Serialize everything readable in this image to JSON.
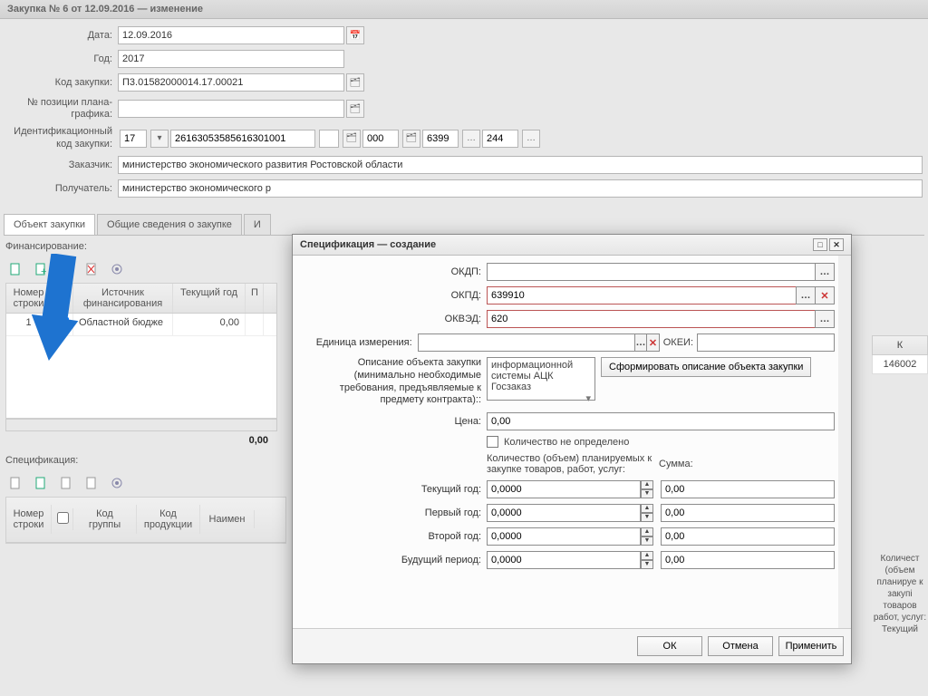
{
  "main": {
    "title": "Закупка № 6 от 12.09.2016 — изменение",
    "labels": {
      "date": "Дата:",
      "year": "Год:",
      "purchase_code": "Код закупки:",
      "plan_position": "№ позиции плана-графика:",
      "id_code": "Идентификационный код закупки:",
      "customer": "Заказчик:",
      "recipient": "Получатель:"
    },
    "values": {
      "date": "12.09.2016",
      "year": "2017",
      "purchase_code": "П3.01582000014.17.00021",
      "id1": "17",
      "id2": "26163053585616301001",
      "id3": "000",
      "id4": "6399",
      "id5": "244",
      "customer": "министерство экономического развития Ростовской области",
      "recipient": "министерство экономического р"
    }
  },
  "tabs": {
    "t1": "Объект закупки",
    "t2": "Общие сведения о закупке",
    "t3": "И"
  },
  "financing": {
    "label": "Финансирование:",
    "cols": {
      "row_no": "Номер строки",
      "chk": " ",
      "source": "Источник финансирования",
      "current": "Текущий год",
      "p": "П"
    },
    "row": {
      "no": "1",
      "source": "Областной бюдже",
      "current": "0,00"
    },
    "total": "0,00"
  },
  "spec_section": {
    "label": "Спецификация:"
  },
  "spec_grid": {
    "cols": {
      "row_no": "Номер строки",
      "chk": " ",
      "group_code": "Код группы",
      "prod_code": "Код продукции",
      "name": "Наимен"
    }
  },
  "rightcol": {
    "head": "К",
    "val": "146002"
  },
  "rightblock2": "Количест (объем планируе к закупі товаров работ, услуг: Текущий",
  "dialog": {
    "title": "Спецификация — создание",
    "labels": {
      "okdp": "ОКДП:",
      "okpd": "ОКПД:",
      "okved": "ОКВЭД:",
      "unit": "Единица измерения:",
      "okei": "ОКЕИ:",
      "description": "Описание объекта закупки (минимально необходимые требования, предъявляемые к предмету контракта)::",
      "gen_button": "Сформировать описание объекта закупки",
      "price": "Цена:",
      "qty_undef": "Количество не определено",
      "qty_header": "Количество (объем) планируемых к закупке товаров, работ, услуг:",
      "sum_header": "Сумма:",
      "cur_year": "Текущий год:",
      "first_year": "Первый год:",
      "second_year": "Второй год:",
      "future": "Будущий период:"
    },
    "values": {
      "okpd": "639910",
      "okved": "620",
      "desc_lines": "информационной системы АЦК Госзаказ",
      "price": "0,00",
      "cur_year_q": "0,0000",
      "cur_year_s": "0,00",
      "first_year_q": "0,0000",
      "first_year_s": "0,00",
      "second_year_q": "0,0000",
      "second_year_s": "0,00",
      "future_q": "0,0000",
      "future_s": "0,00"
    },
    "buttons": {
      "ok": "ОК",
      "cancel": "Отмена",
      "apply": "Применить"
    }
  }
}
